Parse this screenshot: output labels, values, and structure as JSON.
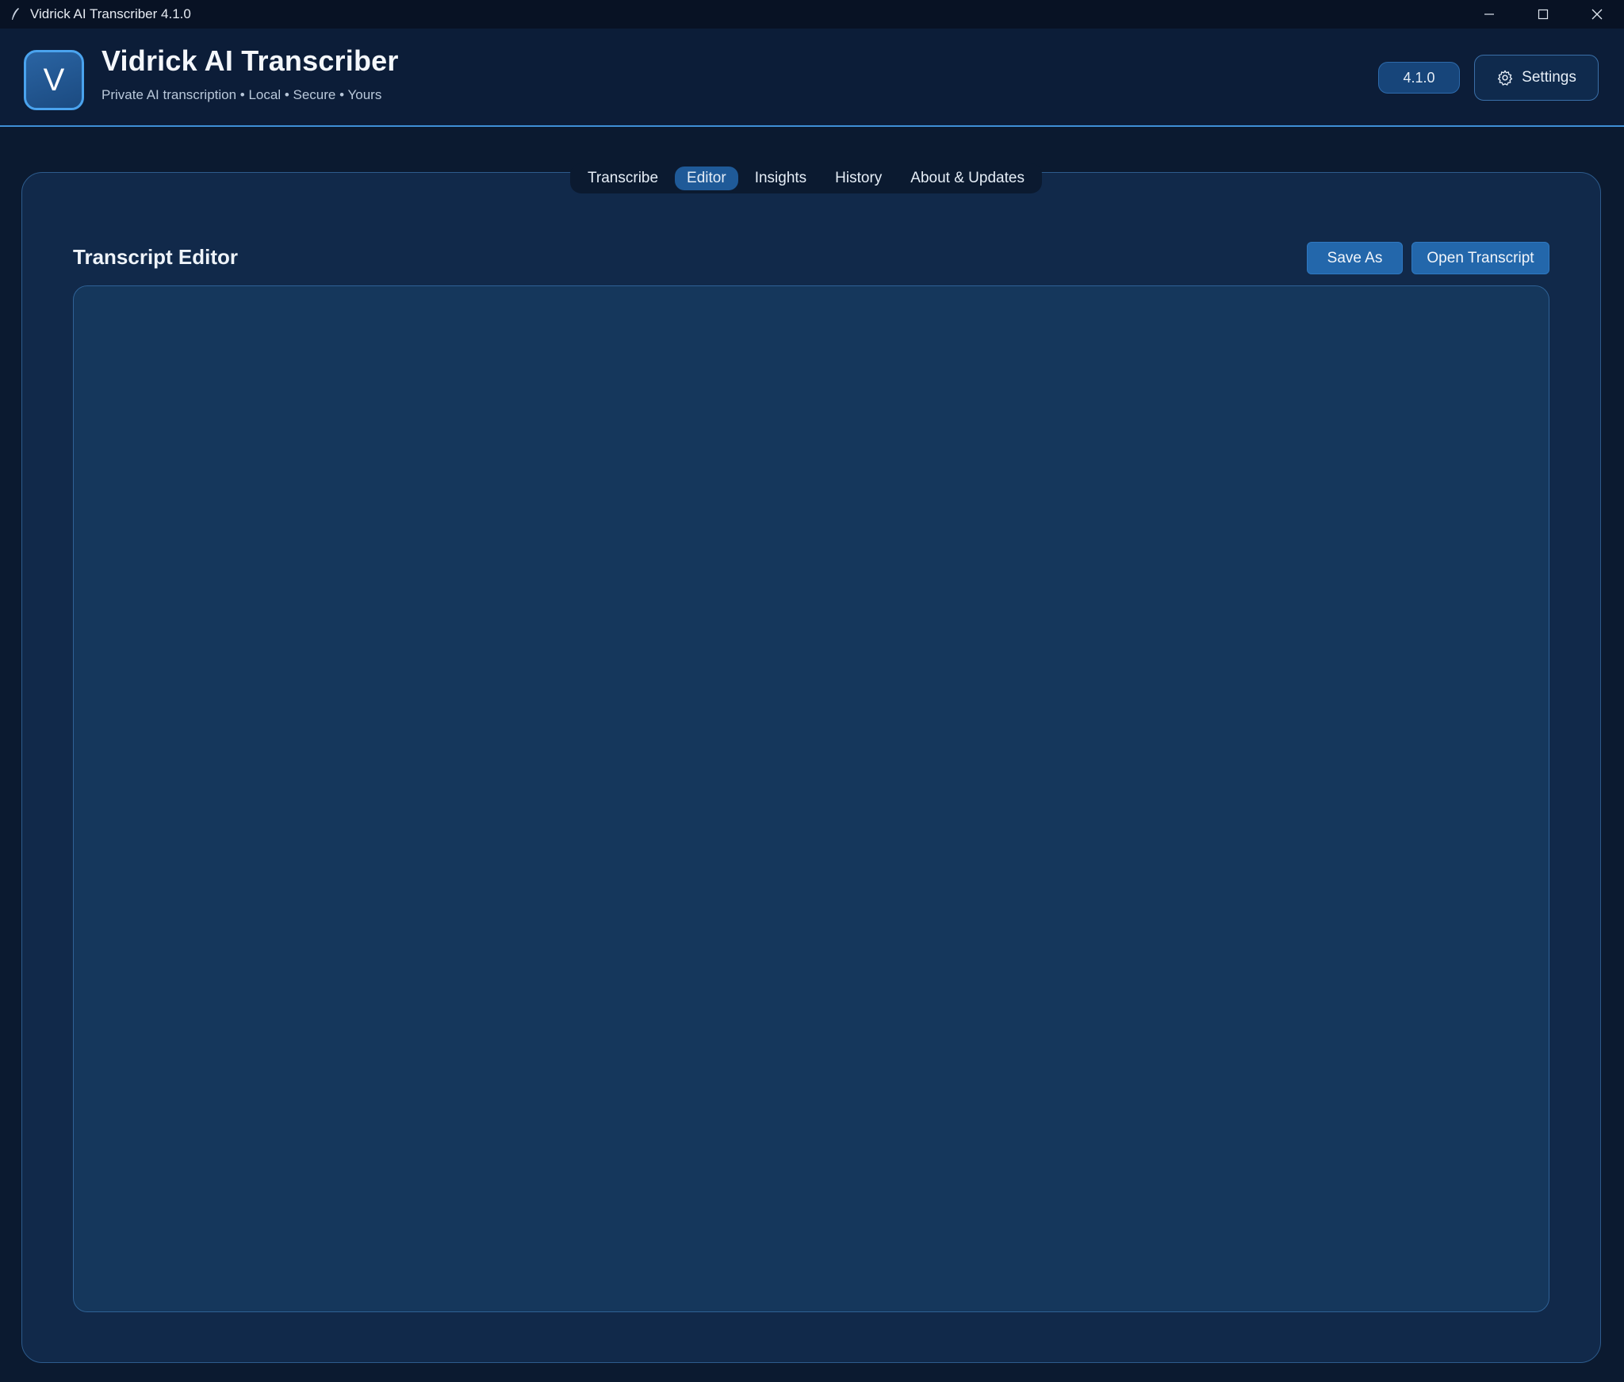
{
  "window": {
    "title": "Vidrick AI Transcriber 4.1.0",
    "icon": "quill-icon",
    "controls": [
      "minimize-icon",
      "maximize-icon",
      "close-icon"
    ]
  },
  "header": {
    "logo_letter": "V",
    "app_name": "Vidrick AI Transcriber",
    "tagline": "Private AI transcription • Local • Secure • Yours",
    "version": "4.1.0",
    "settings_label": "Settings",
    "settings_icon": "gear-icon"
  },
  "tabs": [
    {
      "label": "Transcribe",
      "active": false
    },
    {
      "label": "Editor",
      "active": true
    },
    {
      "label": "Insights",
      "active": false
    },
    {
      "label": "History",
      "active": false
    },
    {
      "label": "About & Updates",
      "active": false
    }
  ],
  "editor": {
    "title": "Transcript Editor",
    "save_as_label": "Save As",
    "open_label": "Open Transcript",
    "content": ""
  },
  "colors": {
    "accent": "#3f8fd6",
    "primary_button": "#2367ab",
    "active_tab": "#1f5a98",
    "panel": "#11294a",
    "editor_bg": "#15375c"
  }
}
